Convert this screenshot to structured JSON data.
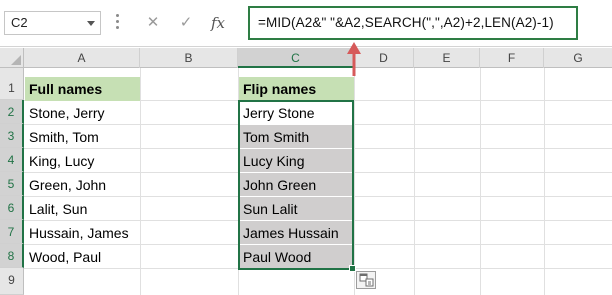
{
  "name_box": {
    "value": "C2"
  },
  "formula_bar": {
    "cancel_symbol": "✕",
    "enter_symbol": "✓",
    "fx_symbol": "fx",
    "formula": "=MID(A2&\" \"&A2,SEARCH(\",\",A2)+2,LEN(A2)-1)"
  },
  "columns": [
    "A",
    "B",
    "C",
    "D",
    "E",
    "F",
    "G"
  ],
  "selected_column": "C",
  "rows": [
    "1",
    "2",
    "3",
    "4",
    "5",
    "6",
    "7",
    "8",
    "9"
  ],
  "column_a": {
    "header": "Full names",
    "values": [
      "Stone, Jerry",
      "Smith, Tom",
      "King, Lucy",
      "Green, John",
      "Lalit, Sun",
      "Hussain, James",
      "Wood, Paul"
    ]
  },
  "column_c": {
    "header": "Flip names",
    "values": [
      "Jerry Stone",
      "Tom Smith",
      "Lucy King",
      "John Green",
      "Sun Lalit",
      "James Hussain",
      "Paul Wood"
    ]
  },
  "colors": {
    "header_fill": "#c6e0b4",
    "selection_fill": "#d0cece",
    "excel_green": "#217346",
    "arrow": "#d65a5a"
  },
  "icons": {
    "namebox_dropdown": "chevron-down-icon",
    "paste_options": "paste-options-icon",
    "annotation_arrow": "arrow-up-icon"
  }
}
